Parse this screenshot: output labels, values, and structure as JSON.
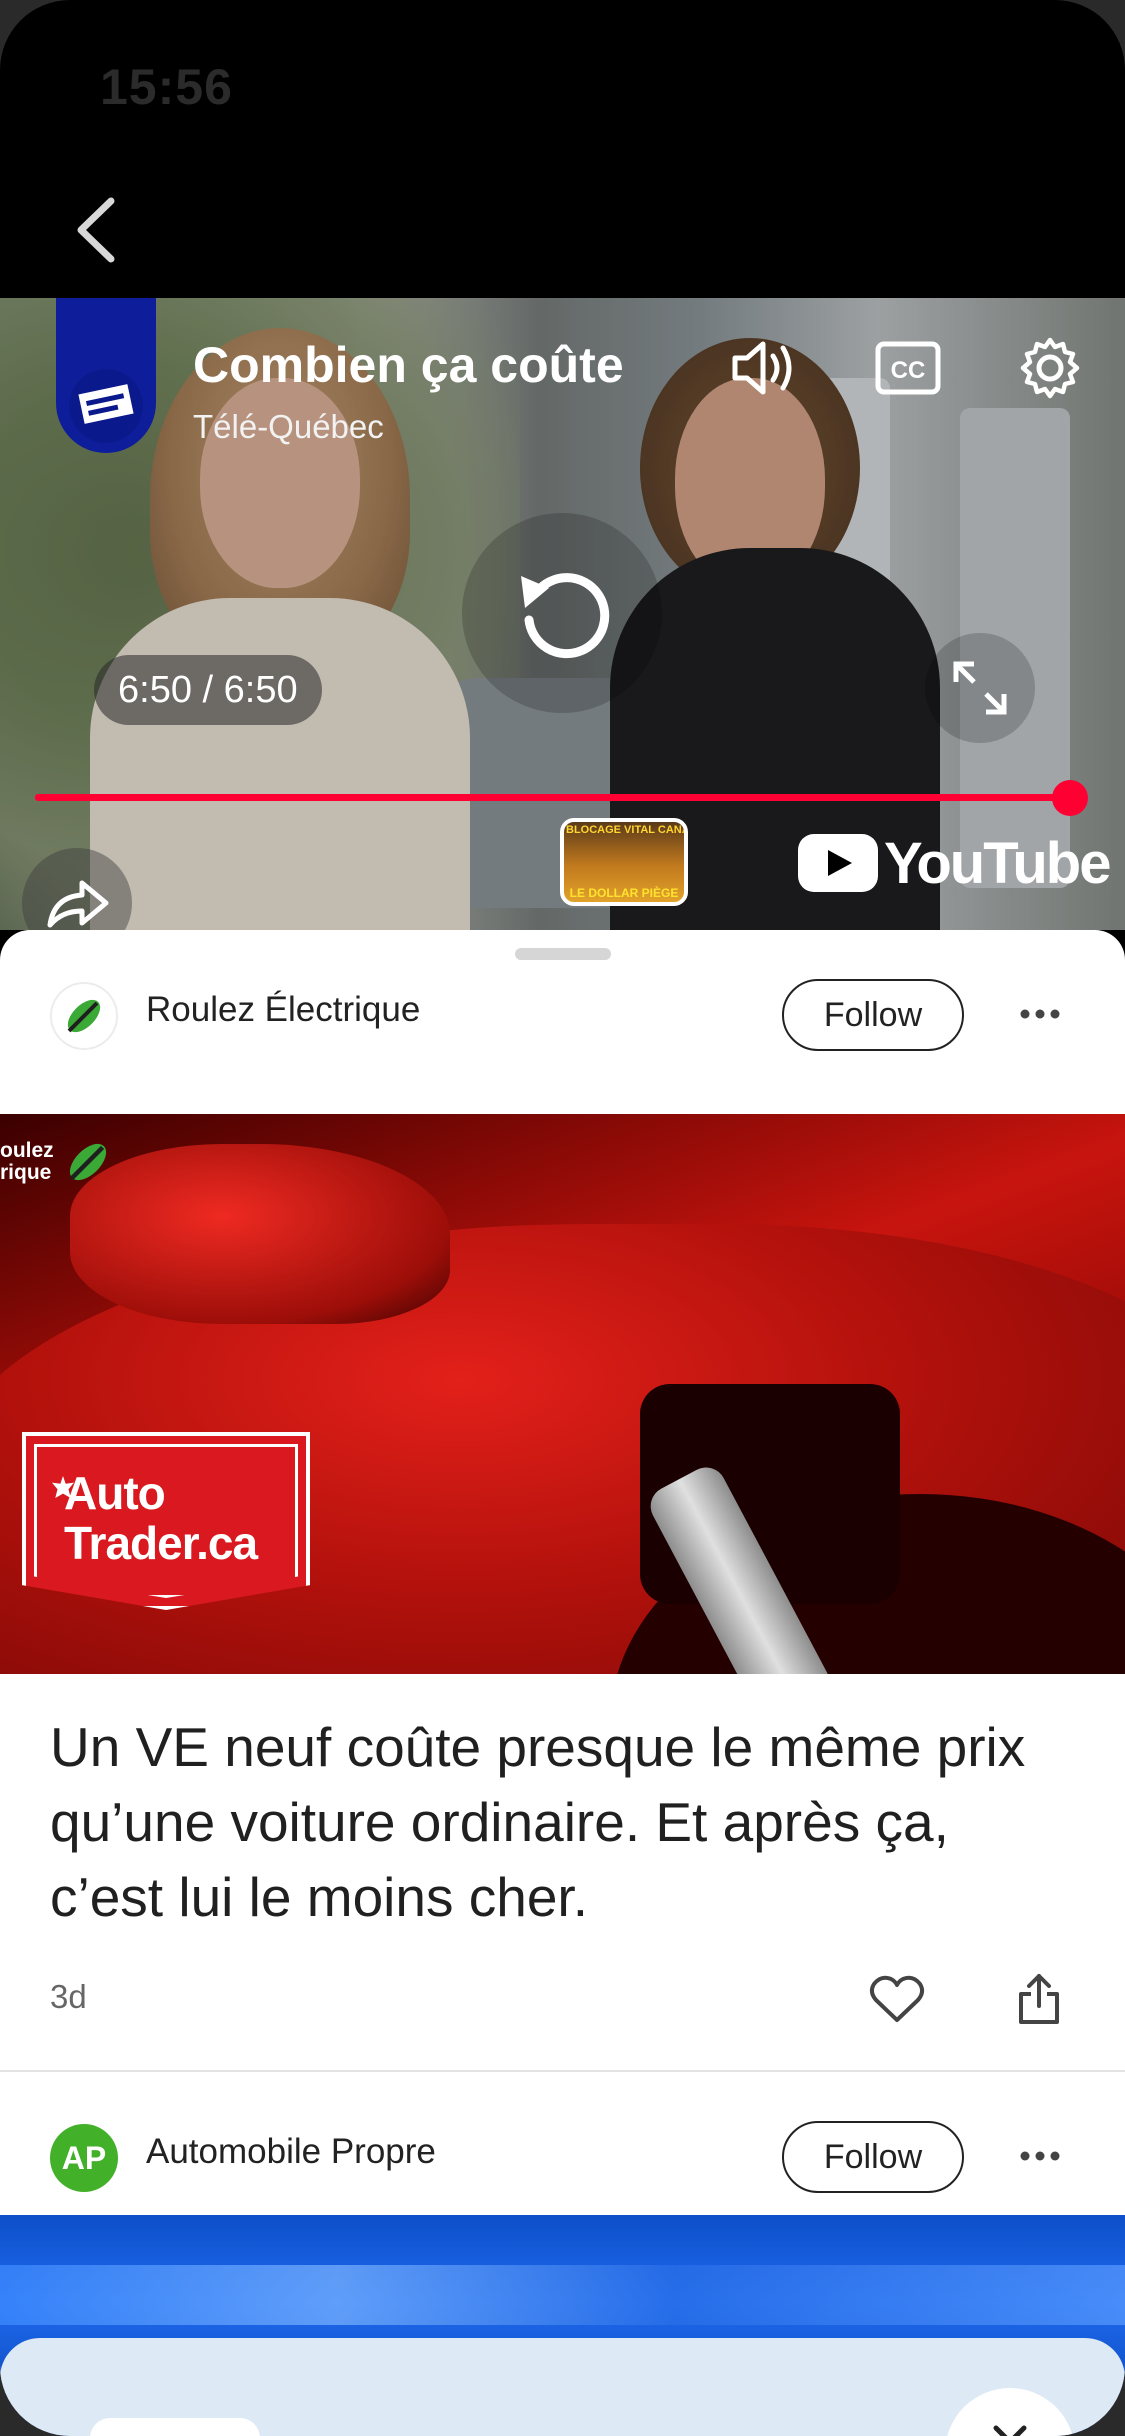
{
  "status_bar": {
    "time": "15:56"
  },
  "video": {
    "title": "Combien ça coûte",
    "channel": "Télé-Québec",
    "time_display": "6:50 / 6:50",
    "progress_fraction": 1.0,
    "thumbnail_text_top": "BLOCAGE VITAL CANADA",
    "thumbnail_text_bottom": "LE DOLLAR PIÈGE",
    "youtube_wordmark": "YouTube",
    "accent_color": "#ff0033"
  },
  "feed": {
    "items": [
      {
        "source": "Roulez Électrique",
        "follow_label": "Follow",
        "watermark_line1": "oulez",
        "watermark_line2": "rique",
        "badge_line1": "Auto",
        "badge_line2": "Trader.ca",
        "headline": "Un VE neuf coûte presque le même prix qu’une voiture ordinaire. Et après ça, c’est lui le moins cher.",
        "age": "3d"
      },
      {
        "source": "Automobile Propre",
        "avatar_text": "AP",
        "follow_label": "Follow"
      }
    ]
  }
}
